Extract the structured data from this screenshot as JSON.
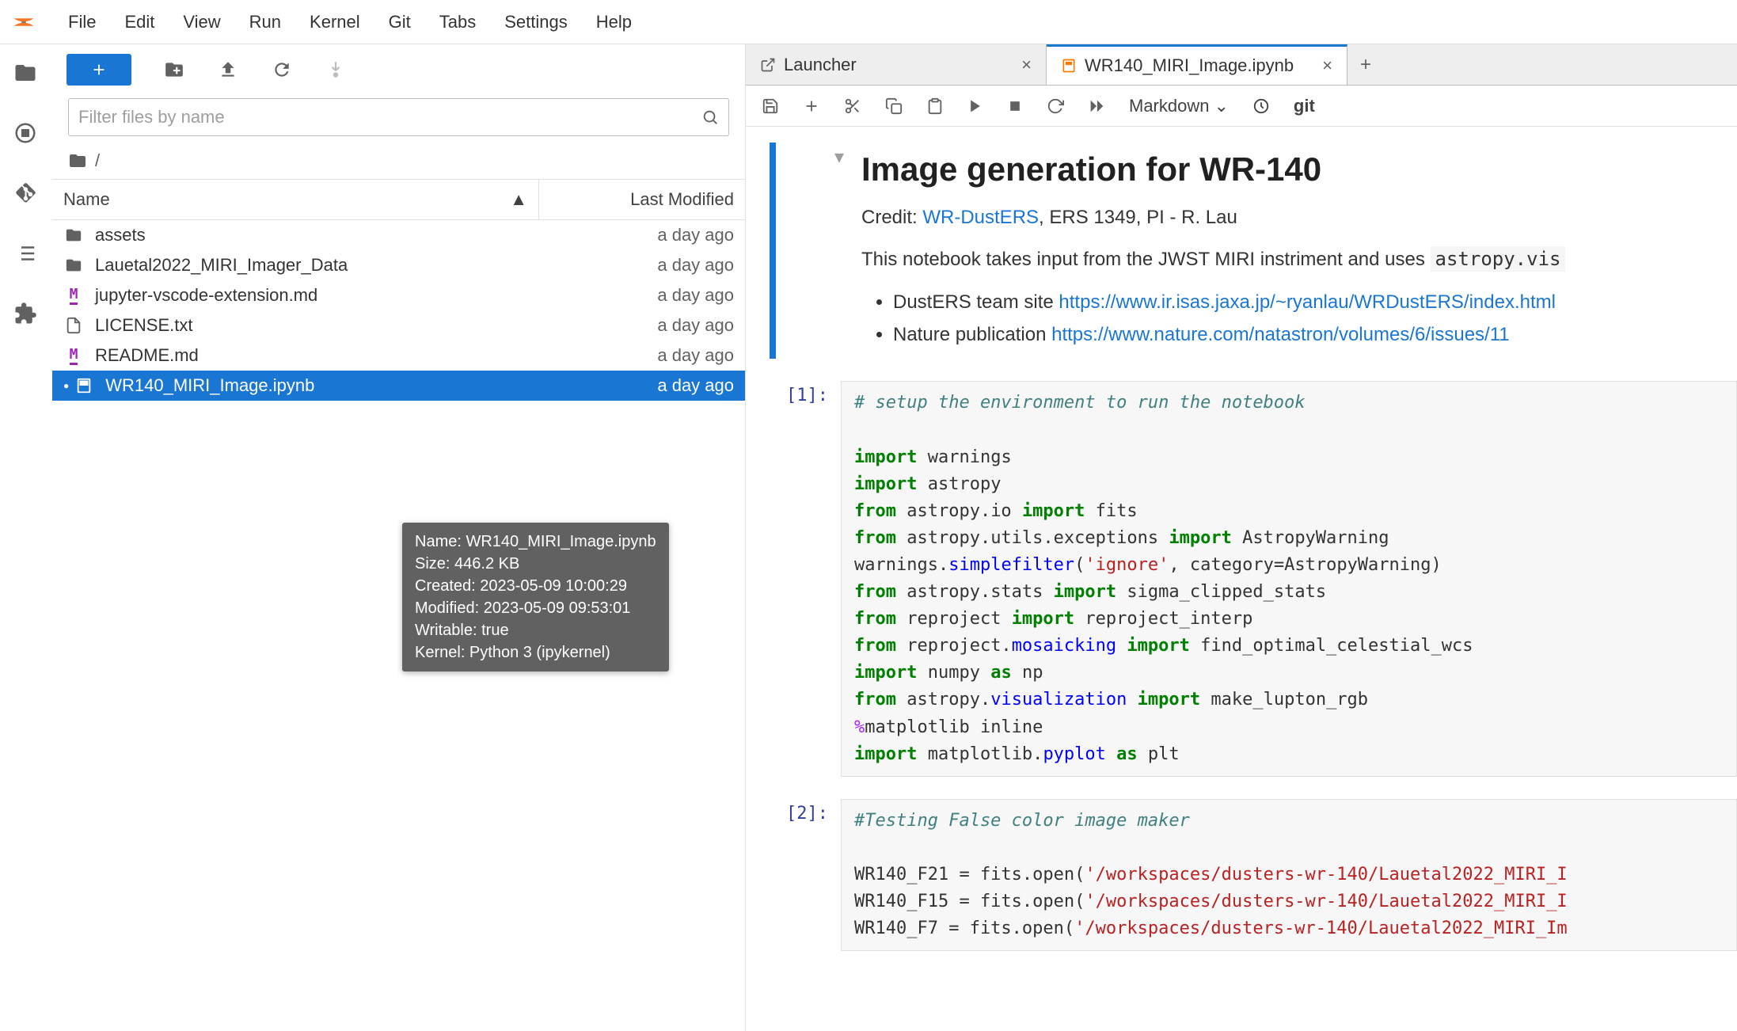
{
  "menu": [
    "File",
    "Edit",
    "View",
    "Run",
    "Kernel",
    "Git",
    "Tabs",
    "Settings",
    "Help"
  ],
  "sidebar": {
    "filter_placeholder": "Filter files by name",
    "breadcrumb": "/",
    "columns": {
      "name": "Name",
      "modified": "Last Modified"
    },
    "files": [
      {
        "icon": "folder",
        "name": "assets",
        "modified": "a day ago"
      },
      {
        "icon": "folder",
        "name": "Lauetal2022_MIRI_Imager_Data",
        "modified": "a day ago"
      },
      {
        "icon": "markdown",
        "name": "jupyter-vscode-extension.md",
        "modified": "a day ago"
      },
      {
        "icon": "file",
        "name": "LICENSE.txt",
        "modified": "a day ago"
      },
      {
        "icon": "markdown",
        "name": "README.md",
        "modified": "a day ago"
      },
      {
        "icon": "notebook",
        "name": "WR140_MIRI_Image.ipynb",
        "modified": "a day ago",
        "selected": true
      }
    ]
  },
  "tooltip": {
    "l1": "Name: WR140_MIRI_Image.ipynb",
    "l2": "Size: 446.2 KB",
    "l3": "Created: 2023-05-09 10:00:29",
    "l4": "Modified: 2023-05-09 09:53:01",
    "l5": "Writable: true",
    "l6": "Kernel: Python 3 (ipykernel)"
  },
  "tabs": [
    {
      "icon": "launcher",
      "label": "Launcher",
      "active": false
    },
    {
      "icon": "notebook",
      "label": "WR140_MIRI_Image.ipynb",
      "active": true
    }
  ],
  "nb_toolbar": {
    "cell_type": "Markdown",
    "git": "git"
  },
  "markdown": {
    "title": "Image generation for WR-140",
    "credit_prefix": "Credit: ",
    "credit_link": "WR-DustERS",
    "credit_suffix": ", ERS 1349, PI - R. Lau",
    "desc_prefix": "This notebook takes input from the JWST MIRI instriment and uses ",
    "desc_code": "astropy.vis",
    "li1_prefix": "DustERS team site ",
    "li1_link": "https://www.ir.isas.jaxa.jp/~ryanlau/WRDustERS/index.html",
    "li2_prefix": "Nature publication ",
    "li2_link": "https://www.nature.com/natastron/volumes/6/issues/11"
  },
  "prompts": {
    "c1": "[1]:",
    "c2": "[2]:"
  },
  "code1": {
    "l0": "# setup the environment to run the notebook",
    "l1a": "import",
    "l1b": " warnings",
    "l2a": "import",
    "l2b": " astropy",
    "l3a": "from",
    "l3b": " astropy.io ",
    "l3c": "import",
    "l3d": " fits",
    "l4a": "from",
    "l4b": " astropy.utils.exceptions ",
    "l4c": "import",
    "l4d": " AstropyWarning",
    "l5": "warnings.simplefilter('ignore', category=AstropyWarning)",
    "l6a": "from",
    "l6b": " astropy.stats ",
    "l6c": "import",
    "l6d": " sigma_clipped_stats",
    "l7a": "from",
    "l7b": " reproject ",
    "l7c": "import",
    "l7d": " reproject_interp",
    "l8a": "from",
    "l8b": " reproject.mosaicking ",
    "l8c": "import",
    "l8d": " find_optimal_celestial_wcs",
    "l9a": "import",
    "l9b": " numpy ",
    "l9c": "as",
    "l9d": " np",
    "l10a": "from",
    "l10b": " astropy.visualization ",
    "l10c": "import",
    "l10d": " make_lupton_rgb",
    "l11a": "%",
    "l11b": "matplotlib inline",
    "l12a": "import",
    "l12b": " matplotlib.pyplot ",
    "l12c": "as",
    "l12d": " plt"
  },
  "code2": {
    "l0": "#Testing False color image maker",
    "l1": "WR140_F21 = fits.open('/workspaces/dusters-wr-140/Lauetal2022_MIRI_I",
    "l2": "WR140_F15 = fits.open('/workspaces/dusters-wr-140/Lauetal2022_MIRI_I",
    "l3": "WR140_F7 = fits.open('/workspaces/dusters-wr-140/Lauetal2022_MIRI_Im"
  }
}
